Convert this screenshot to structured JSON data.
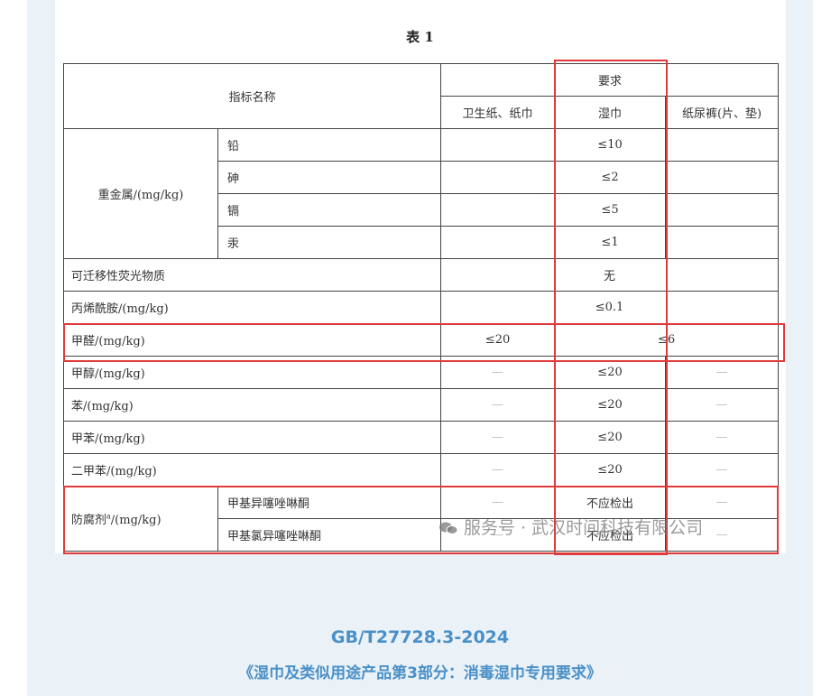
{
  "table_title": "表 1",
  "header": {
    "indicator": "指标名称",
    "requirement": "要求",
    "col_toilet": "卫生纸、纸巾",
    "col_wipes": "湿巾",
    "col_diaper": "纸尿裤(片、垫)"
  },
  "heavy_metals": {
    "label": "重金属/(mg/kg)",
    "rows": [
      {
        "name": "铅",
        "wipes": "≤10"
      },
      {
        "name": "砷",
        "wipes": "≤2"
      },
      {
        "name": "镉",
        "wipes": "≤5"
      },
      {
        "name": "汞",
        "wipes": "≤1"
      }
    ]
  },
  "fluorescent": {
    "name": "可迁移性荧光物质",
    "value": "无"
  },
  "acrylamide": {
    "name": "丙烯酰胺/(mg/kg)",
    "value": "≤0.1"
  },
  "formaldehyde": {
    "name": "甲醛/(mg/kg)",
    "toilet": "≤20",
    "wipes_diaper": "≤6"
  },
  "solvents": [
    {
      "name": "甲醇/(mg/kg)",
      "toilet": "—",
      "wipes": "≤20",
      "diaper": "—"
    },
    {
      "name": "苯/(mg/kg)",
      "toilet": "—",
      "wipes": "≤20",
      "diaper": "—"
    },
    {
      "name": "甲苯/(mg/kg)",
      "toilet": "—",
      "wipes": "≤20",
      "diaper": "—"
    },
    {
      "name": "二甲苯/(mg/kg)",
      "toilet": "—",
      "wipes": "≤20",
      "diaper": "—"
    }
  ],
  "preservative": {
    "label": "防腐剂",
    "note_mark": "a",
    "unit": "/(mg/kg)",
    "rows": [
      {
        "name": "甲基异噻唑啉酮",
        "toilet": "—",
        "wipes": "不应检出",
        "diaper": "—"
      },
      {
        "name": "甲基氯异噻唑啉酮",
        "toilet": "—",
        "wipes": "不应检出",
        "diaper": "—"
      }
    ]
  },
  "watermark": "服务号 · 武汉时间科技有限公司",
  "caption": {
    "standard": "GB/T27728.3-2024",
    "title": "《湿巾及类似用途产品第3部分：消毒湿巾专用要求》"
  },
  "colors": {
    "highlight": "#e03a3a",
    "caption": "#4a90c8",
    "background": "#eaf1f7"
  }
}
